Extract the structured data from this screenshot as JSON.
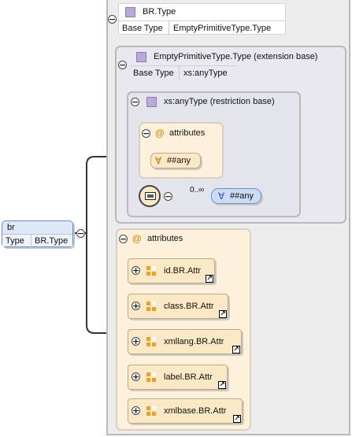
{
  "root": {
    "name": "br",
    "type_label": "Type",
    "type_value": "BR.Type"
  },
  "br_type": {
    "title": "BR.Type",
    "base_label": "Base Type",
    "base_value": "EmptyPrimitiveType.Type"
  },
  "empty_primitive": {
    "title": "EmptyPrimitiveType.Type (extension base)",
    "base_label": "Base Type",
    "base_value": "xs:anyType"
  },
  "any_type": {
    "title": "xs:anyType (restriction base)"
  },
  "inner_attributes": {
    "title": "attributes",
    "any_label": "##any"
  },
  "sequence": {
    "cardinality": "0..∞",
    "any_label": "##any"
  },
  "attributes": {
    "title": "attributes",
    "items": [
      {
        "label": "id.BR.Attr"
      },
      {
        "label": "class.BR.Attr"
      },
      {
        "label": "xmllang.BR.Attr"
      },
      {
        "label": "label.BR.Attr"
      },
      {
        "label": "xmlbase.BR.Attr"
      }
    ]
  },
  "colors": {
    "type_box": "#b9a9d9",
    "attr_icon": "#f0a020",
    "any_pill": "#cbdcf7",
    "peach": "#fdf1dc"
  }
}
